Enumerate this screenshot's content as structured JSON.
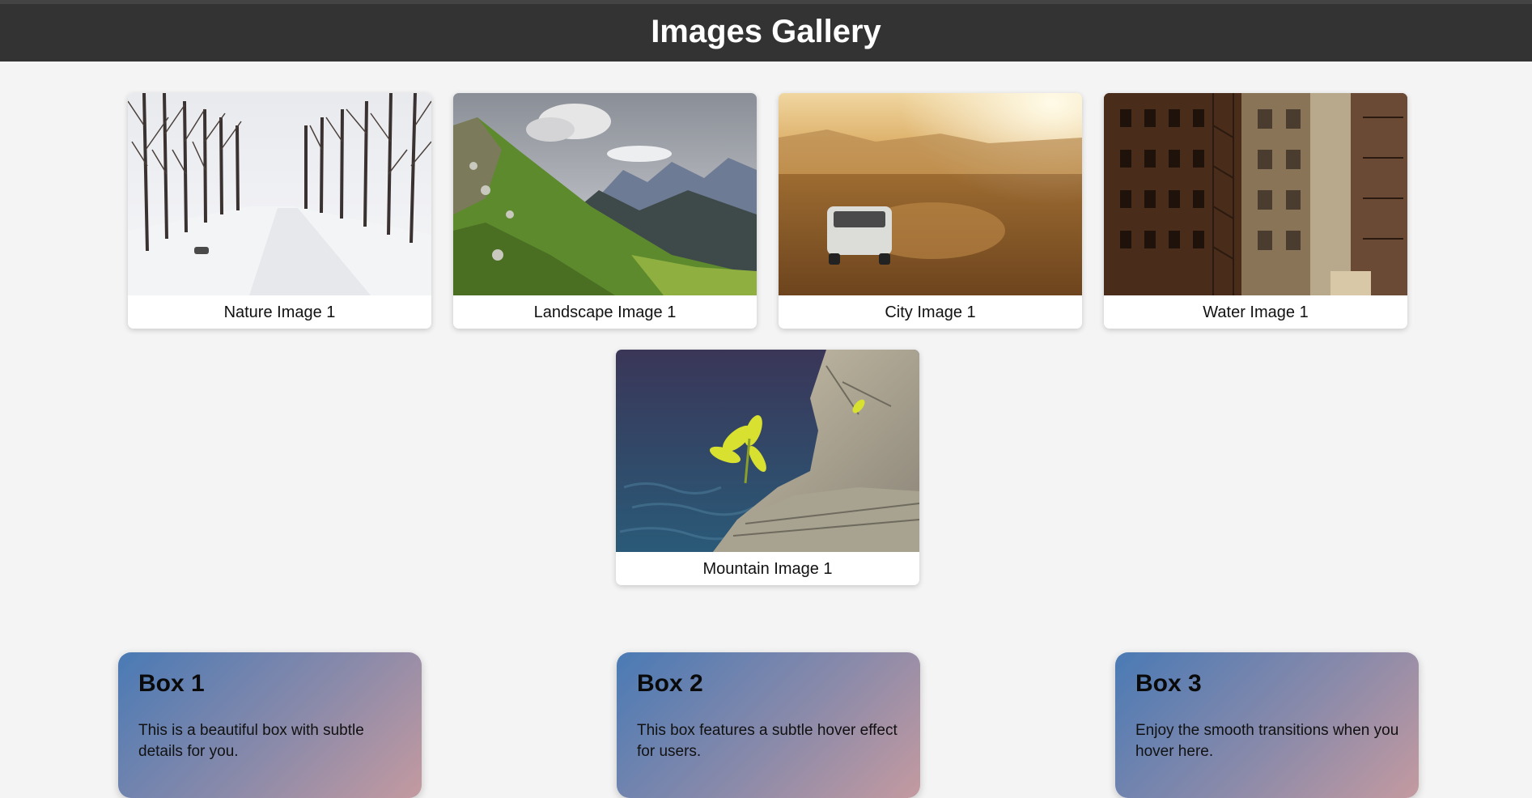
{
  "header": {
    "title": "Images Gallery"
  },
  "gallery": [
    {
      "caption": "Nature Image 1",
      "scene": "snowy-forest-road"
    },
    {
      "caption": "Landscape Image 1",
      "scene": "green-mountain-valley"
    },
    {
      "caption": "City Image 1",
      "scene": "van-in-desert-dust"
    },
    {
      "caption": "Water Image 1",
      "scene": "city-brick-buildings"
    },
    {
      "caption": "Mountain Image 1",
      "scene": "plant-on-rock-by-water"
    }
  ],
  "boxes": [
    {
      "title": "Box 1",
      "text": "This is a beautiful box with subtle details for you."
    },
    {
      "title": "Box 2",
      "text": "This box features a subtle hover effect for users."
    },
    {
      "title": "Box 3",
      "text": "Enjoy the smooth transitions when you hover here."
    }
  ],
  "colors": {
    "header_bg": "#333333",
    "page_bg": "#f4f4f4",
    "box_gradient_start": "#4a7ab5",
    "box_gradient_end": "#c49aa0"
  }
}
